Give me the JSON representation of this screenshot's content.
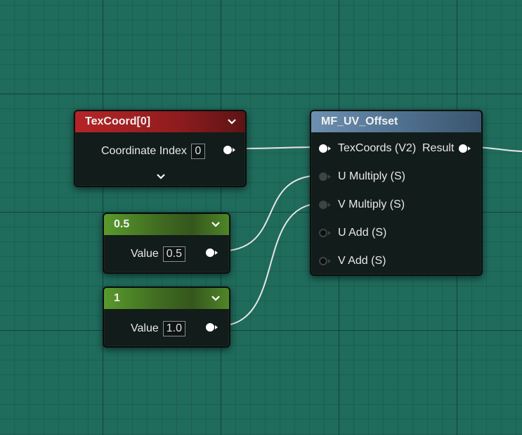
{
  "colors": {
    "canvas": "#1f6b5c",
    "wire": "#e6e6e6",
    "pin_connected": "#ffffff",
    "pin_disconnected": "#3a3f3e"
  },
  "icons": {
    "collapse": "chevron-down-icon",
    "expand": "chevron-down-icon"
  },
  "nodes": {
    "texcoord": {
      "title": "TexCoord[0]",
      "coord_label": "Coordinate Index",
      "coord_value": "0"
    },
    "const_half": {
      "title": "0.5",
      "value_label": "Value",
      "value": "0.5"
    },
    "const_one": {
      "title": "1",
      "value_label": "Value",
      "value": "1.0"
    },
    "mf_uv_offset": {
      "title": "MF_UV_Offset",
      "inputs": [
        "TexCoords (V2)",
        "U Multiply (S)",
        "V Multiply (S)",
        "U Add (S)",
        "V Add (S)"
      ],
      "output": "Result"
    }
  }
}
